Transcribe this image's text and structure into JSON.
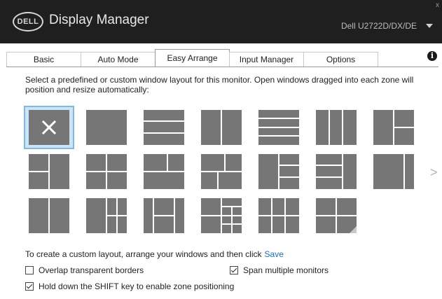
{
  "window": {
    "logo_text": "DELL",
    "title": "Display Manager",
    "monitor": "Dell U2722D/DX/DE",
    "close_glyph": "x"
  },
  "tabs": [
    {
      "label": "Basic"
    },
    {
      "label": "Auto Mode"
    },
    {
      "label": "Easy Arrange"
    },
    {
      "label": "Input Manager"
    },
    {
      "label": "Options"
    }
  ],
  "active_tab": "Easy Arrange",
  "info_glyph": "i",
  "description": "Select a predefined or custom window layout for this monitor.  Open windows dragged into each zone will position and resize automatically:",
  "layouts": {
    "count": 20,
    "selected": "none",
    "next_glyph": ">"
  },
  "custom_text": "To create a custom layout, arrange your windows and then click",
  "save_link": "Save",
  "options": {
    "overlap": {
      "label": "Overlap transparent borders",
      "checked": false
    },
    "span": {
      "label": "Span multiple monitors",
      "checked": true
    },
    "shift": {
      "label": "Hold down the SHIFT key to enable zone positioning",
      "checked": true
    }
  },
  "colors": {
    "titlebar": "#1f1f1f",
    "zone": "#767676",
    "link": "#1a6fc4",
    "selection": "#cce4f7"
  }
}
